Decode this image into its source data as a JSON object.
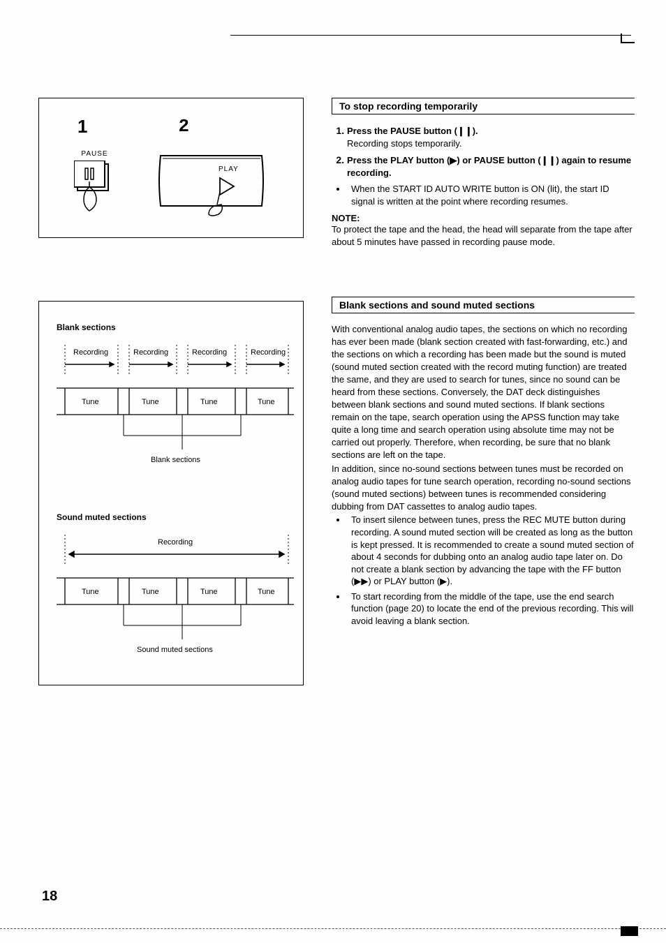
{
  "page_number": "18",
  "figure1": {
    "num1": "1",
    "num2": "2",
    "pause_label": "PAUSE",
    "play_label": "PLAY"
  },
  "diagram1": {
    "title": "Blank sections",
    "top_labels": [
      "Recording",
      "Recording",
      "Recording",
      "Recording"
    ],
    "bottom_labels": [
      "Tune",
      "Tune",
      "Tune",
      "Tune"
    ],
    "caption": "Blank sections"
  },
  "diagram2": {
    "title": "Sound muted sections",
    "top_label": "Recording",
    "bottom_labels": [
      "Tune",
      "Tune",
      "Tune",
      "Tune"
    ],
    "caption": "Sound muted sections"
  },
  "section1": {
    "heading": "To stop recording temporarily",
    "step1_bold": "Press the PAUSE button (❙❙).",
    "step1_body": "Recording stops temporarily.",
    "step2_bold": "Press the PLAY button (▶) or PAUSE button (❙❙) again to resume recording.",
    "bullet1": "When the START ID AUTO WRITE button is ON (lit), the start ID signal is written at the point where recording resumes.",
    "note_head": "NOTE:",
    "note_body": "To protect the tape and the head, the head will separate from the tape after about 5 minutes have passed in recording pause mode."
  },
  "section2": {
    "heading": "Blank sections and sound muted sections",
    "para1": "With conventional analog audio tapes, the sections on which no recording has ever been made (blank section created with fast-forwarding, etc.) and the sections on which a recording has been made but the sound is muted (sound muted section created with the record muting function) are treated the same, and they are used to search for tunes, since no sound can be heard from these sections. Conversely, the DAT deck distinguishes between blank sections and sound muted sections. If blank sections remain on the tape, search operation using the APSS function may take quite a long time and search operation using absolute time may not be carried out properly. Therefore, when recording, be sure that no blank sections are left on the tape.",
    "para2": "In addition, since no-sound sections between tunes must be recorded on analog audio tapes for tune search operation, recording no-sound sections (sound muted sections) between tunes is recommended considering dubbing from DAT cassettes to analog audio tapes.",
    "bullet1": "To insert silence between tunes, press the REC MUTE button during recording. A sound muted section will be created as long as the button is kept pressed. It is recommended to create a sound muted section of about 4 seconds for dubbing onto an analog audio tape later on. Do not create a blank section by advancing the tape with the FF button (▶▶) or PLAY button (▶).",
    "bullet2": "To start recording from the middle of the tape, use the end search function (page 20) to locate the end of the previous recording. This will avoid leaving a blank section."
  }
}
